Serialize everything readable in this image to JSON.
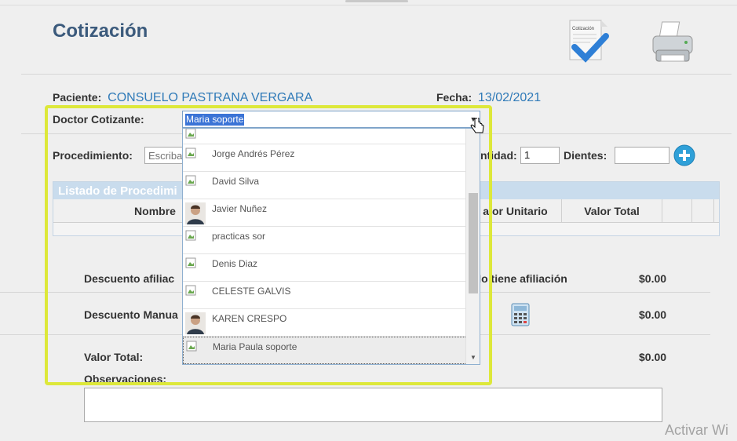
{
  "header": {
    "title": "Cotización",
    "doc_icon_label": "Cotización"
  },
  "patient": {
    "label": "Paciente:",
    "value": "CONSUELO PASTRANA VERGARA"
  },
  "date": {
    "label": "Fecha:",
    "value": "13/02/2021"
  },
  "doctor": {
    "label": "Doctor Cotizante:",
    "selected": "Maria soporte",
    "options": [
      {
        "name": "Jorge Andrés Pérez",
        "photo": false
      },
      {
        "name": "David Silva",
        "photo": false
      },
      {
        "name": "Javier Nuñez",
        "photo": true
      },
      {
        "name": "practicas sor",
        "photo": false
      },
      {
        "name": "Denis Diaz",
        "photo": false
      },
      {
        "name": "CELESTE GALVIS",
        "photo": false
      },
      {
        "name": "KAREN CRESPO",
        "photo": true
      },
      {
        "name": "Maria Paula soporte",
        "photo": false
      }
    ]
  },
  "procedure": {
    "label": "Procedimiento:",
    "placeholder": "Escriba l",
    "quantity_label": "ntidad:",
    "quantity_value": "1",
    "teeth_label": "Dientes:",
    "teeth_value": ""
  },
  "grid": {
    "title": "Listado de Procedimi",
    "columns": [
      "Nombre",
      "alor Unitario",
      "Valor Total"
    ]
  },
  "discounts": {
    "affiliation_label": "Descuento afiliac",
    "affiliation_status": "No tiene afiliación",
    "affiliation_value": "$0.00",
    "manual_label": "Descuento Manua",
    "manual_value": "$0.00"
  },
  "totals": {
    "label": "Valor Total:",
    "value": "$0.00"
  },
  "observations": {
    "label": "Observaciones:",
    "value": ""
  },
  "watermark": "Activar Wi",
  "colors": {
    "title": "#3b5a7c",
    "link_value": "#2f7ab8",
    "highlight_border": "#dde83a",
    "selection": "#3b74d6",
    "add_button": "#2fa0d8"
  }
}
